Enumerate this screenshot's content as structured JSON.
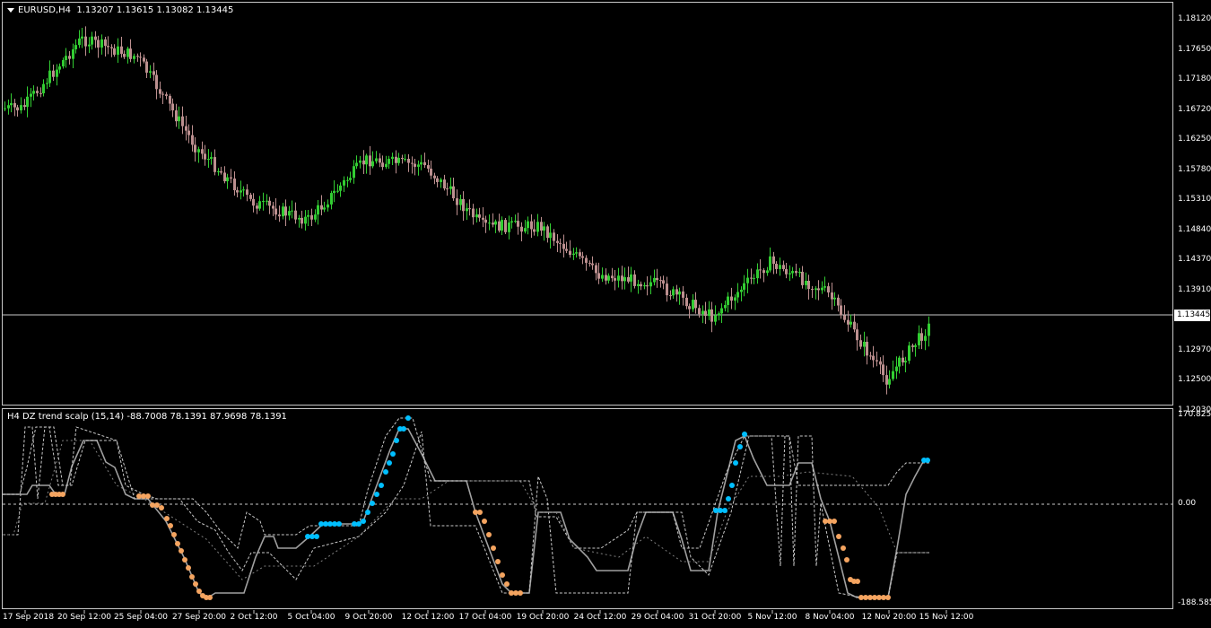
{
  "chart": {
    "symbol_title": "EURUSD,H4",
    "ohlc_text": "1.13207 1.13615 1.13082 1.13445",
    "current_price": "1.13445",
    "price_axis": [
      "1.18120",
      "1.17650",
      "1.17180",
      "1.16720",
      "1.16250",
      "1.15780",
      "1.15310",
      "1.14840",
      "1.14370",
      "1.13910",
      "1.12970",
      "1.12500",
      "1.12030"
    ],
    "colors": {
      "bull": "#32cd32",
      "bear": "#bc8f8f",
      "background": "#000000",
      "grid_line": "#c8c8c8"
    }
  },
  "indicator": {
    "title": "H4 DZ trend scalp (15,14) -88.7008 78.1391 87.9698 78.1391",
    "axis": {
      "top": "170.8259",
      "zero": "0.00",
      "bottom": "-188.5852"
    },
    "colors": {
      "main": "#a0a0a0",
      "up_dots": "#00bfff",
      "down_dots": "#f4a460",
      "bands": "#c8c8c8"
    }
  },
  "time_axis": [
    "17 Sep 2018",
    "20 Sep 12:00",
    "25 Sep 04:00",
    "27 Sep 20:00",
    "2 Oct 12:00",
    "5 Oct 04:00",
    "9 Oct 20:00",
    "12 Oct 12:00",
    "17 Oct 04:00",
    "19 Oct 20:00",
    "24 Oct 12:00",
    "29 Oct 04:00",
    "31 Oct 20:00",
    "5 Nov 12:00",
    "8 Nov 04:00",
    "12 Nov 20:00",
    "15 Nov 12:00"
  ],
  "chart_data": {
    "type": "line",
    "title": "EURUSD,H4",
    "price_path": [
      {
        "t": "17 Sep 2018",
        "price": 1.1675
      },
      {
        "t": "20 Sep 12:00",
        "price": 1.179
      },
      {
        "t": "25 Sep 04:00",
        "price": 1.176
      },
      {
        "t": "27 Sep 20:00",
        "price": 1.161
      },
      {
        "t": "2 Oct 12:00",
        "price": 1.152
      },
      {
        "t": "5 Oct 04:00",
        "price": 1.149
      },
      {
        "t": "9 Oct 20:00",
        "price": 1.159
      },
      {
        "t": "12 Oct 12:00",
        "price": 1.158
      },
      {
        "t": "17 Oct 04:00",
        "price": 1.148
      },
      {
        "t": "19 Oct 20:00",
        "price": 1.148
      },
      {
        "t": "24 Oct 12:00",
        "price": 1.14
      },
      {
        "t": "29 Oct 04:00",
        "price": 1.1385
      },
      {
        "t": "31 Oct 20:00",
        "price": 1.133
      },
      {
        "t": "5 Nov 12:00",
        "price": 1.142
      },
      {
        "t": "8 Nov 04:00",
        "price": 1.137
      },
      {
        "t": "12 Nov 20:00",
        "price": 1.1225
      },
      {
        "t": "15 Nov 12:00",
        "price": 1.1344
      }
    ],
    "ylim": [
      1.1185,
      1.184
    ]
  }
}
